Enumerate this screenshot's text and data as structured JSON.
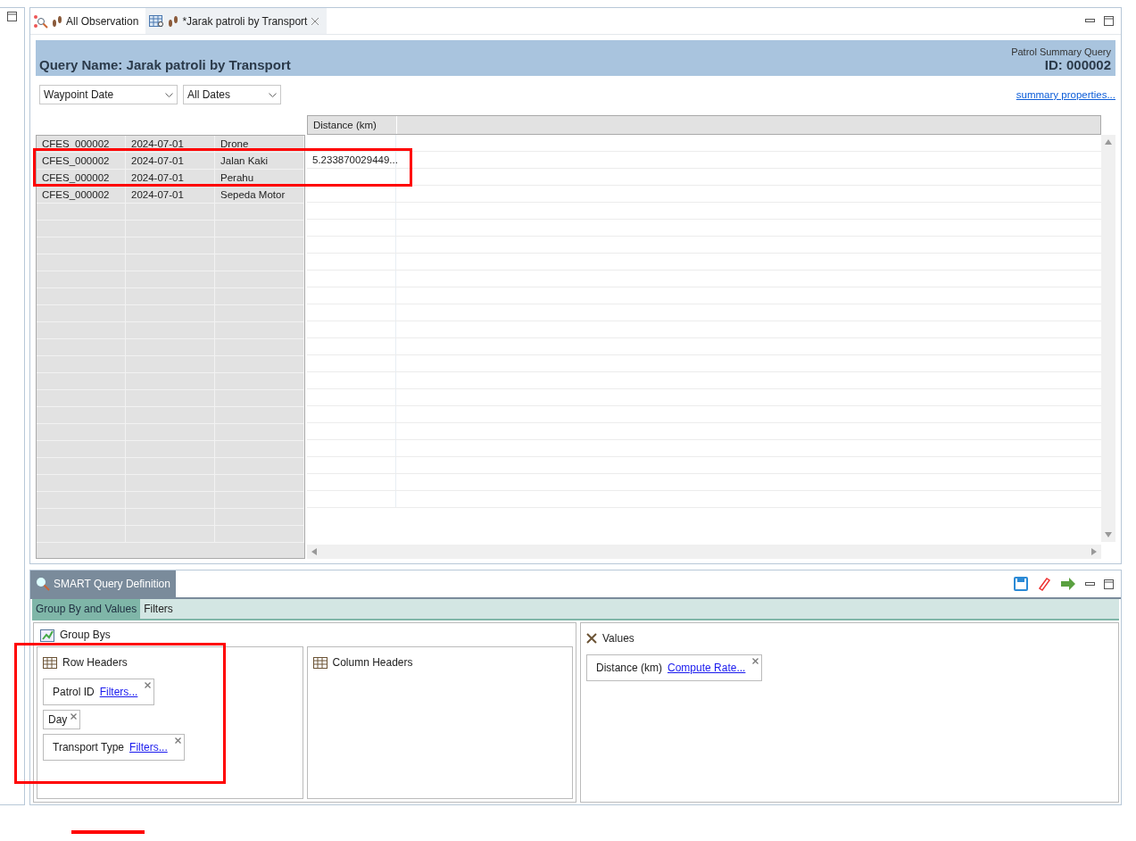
{
  "editor_tabs": [
    {
      "label": "All Observation",
      "selected": false,
      "kind": "observation"
    },
    {
      "label": "*Jarak patroli by Transport",
      "selected": true,
      "kind": "summary"
    }
  ],
  "header": {
    "title": "Query Name: Jarak patroli by Transport",
    "type": "Patrol Summary Query",
    "id": "ID: 000002"
  },
  "filters": [
    {
      "value": "Waypoint Date"
    },
    {
      "value": "All Dates"
    }
  ],
  "summary_link": "summary properties...",
  "table": {
    "columns": [
      "Distance (km)"
    ],
    "rows": [
      {
        "cells": [
          "CFES_000002",
          "2024-07-01",
          "Drone"
        ]
      },
      {
        "cells": [
          "CFES_000002",
          "2024-07-01",
          "Jalan Kaki"
        ],
        "values": [
          "5.233870029449..."
        ]
      },
      {
        "cells": [
          "CFES_000002",
          "2024-07-01",
          "Perahu"
        ]
      },
      {
        "cells": [
          "CFES_000002",
          "2024-07-01",
          "Sepeda Motor"
        ]
      }
    ]
  },
  "definition": {
    "title": "SMART Query Definition",
    "tabs": [
      {
        "label": "Group By and Values",
        "selected": true
      },
      {
        "label": "Filters",
        "selected": false
      }
    ],
    "group_bys_label": "Group Bys",
    "row_headers": {
      "label": "Row Headers",
      "items": [
        {
          "name": "Patrol ID",
          "link": "Filters..."
        },
        {
          "name": "Day"
        },
        {
          "name": "Transport Type",
          "link": "Filters..."
        }
      ]
    },
    "column_headers": {
      "label": "Column Headers"
    },
    "values": {
      "label": "Values",
      "items": [
        {
          "name": "Distance (km)",
          "link": "Compute Rate..."
        }
      ]
    }
  }
}
